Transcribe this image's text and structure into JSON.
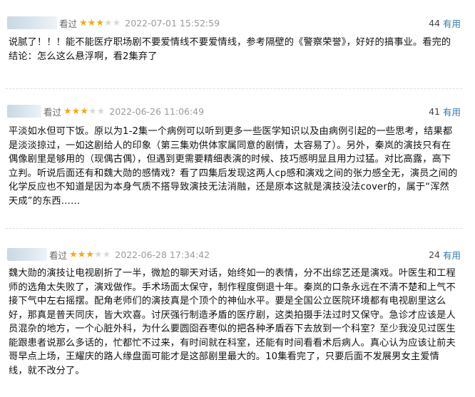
{
  "reviews": [
    {
      "status": "看过",
      "rating": 3,
      "time": "2022-07-01 15:52:59",
      "useful_count": "44",
      "useful_label": "有用",
      "text": "说腻了！！！能不能医疗职场剧不要爱情线不要爱情线，参考隔壁的《警察荣誉》，好好的搞事业。看完的结论：怎么这么悬浮啊，看2集弃了"
    },
    {
      "status": "看过",
      "rating": 3,
      "time": "2022-06-26 11:06:49",
      "useful_count": "41",
      "useful_label": "有用",
      "text": "平淡如水但可下饭。原以为1-2集一个病例可以听到更多一些医学知识以及由病例引起的一些思考，结果都是淡淡掠过，一如这剧给人的印象（第三集劝供体家属同意的剧情，太容易了）。另外，秦岚的演技只有在偶像剧里是够用的（现偶古偶），但遇到更需要精细表演的时候、技巧感明显且用力过猛。对比高露，高下立判。听说后面还有和魏大勋的感情戏？看了四集后发现这两人cp感和演戏之间的张力感全无，演员之间的化学反应也不知道是因为本身气质不搭导致演技无法消融，还是原本这就是演技没法cover的，属于“浑然天成”的东西……"
    },
    {
      "status": "看过",
      "rating": 3,
      "time": "2022-06-28 17:34:42",
      "useful_count": "24",
      "useful_label": "有用",
      "text": "魏大勋的演技让电视剧折了一半，微尬的聊天对话，始终如一的表情，分不出综艺还是演戏。叶医生和工程师的选角太失败了，演戏做作。手术场面太保守，制作程度倒退十年。秦岚的口条永远在不清不楚和上气不接下气中左右摇摆。配角老师们的演技真是个顶个的神仙水平。要是全国公立医院环境都有电视剧里这么好，那真是普天同庆，皆大欢喜。讨厌强行制造矛盾的医疗剧，这类拍摄手法过时又保守。急诊才应该是人员混杂的地方，一个心脏外科，为什么要圆囵吞枣似的把各种矛盾吞下去放到一个科室？至少我没见过医生能跟患者说那么多话的，忙都忙不过来，有时间就在科室，还能有时间看看术后病人。真心认为应该让前夫哥早点上场，王耀庆的路人缘盘面可能才是这部剧里最大的。10集看完了，只要后面不发展男女主爱情线，就不改分了。"
    }
  ],
  "colors": {
    "star_on": "#f2a81a",
    "star_off": "#d9d9d9",
    "useful_label": "#3377aa",
    "time": "#9a9a9a"
  }
}
